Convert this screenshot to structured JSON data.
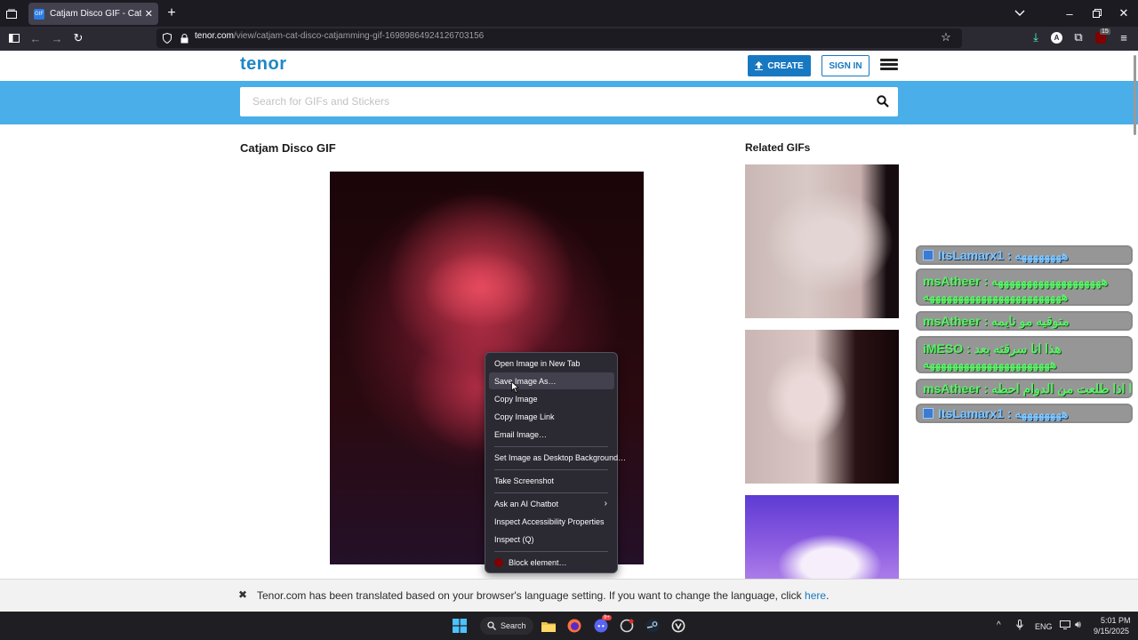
{
  "browser": {
    "tab_title": "Catjam Disco GIF - Catjam Cat Disc",
    "tab_favicon": "GIF",
    "url_host": "tenor.com",
    "url_path": "/view/catjam-cat-disco-catjamming-gif-16989864924126703156",
    "extension_badge": "15"
  },
  "site": {
    "logo": "tenor",
    "create_label": "CREATE",
    "signin_label": "SIGN IN",
    "search_placeholder": "Search for GIFs and Stickers",
    "accent": "#1778c2",
    "band_color": "#4aaee8"
  },
  "main": {
    "title": "Catjam Disco GIF",
    "related_title": "Related GIFs"
  },
  "context_menu": {
    "items": [
      "Open Image in New Tab",
      "Save Image As…",
      "Copy Image",
      "Copy Image Link",
      "Email Image…",
      "Set Image as Desktop Background…",
      "Take Screenshot",
      "Ask an AI Chatbot",
      "Inspect Accessibility Properties",
      "Inspect (Q)",
      "Block element…"
    ]
  },
  "chat": [
    {
      "user": "ItsLamarx1",
      "text": "ههههههههه"
    },
    {
      "user": "msAtheer",
      "text": "هههههههههههههههههههه",
      "text2": "ههههههههههههههههههههههههه"
    },
    {
      "user": "msAtheer",
      "text": "متوقيه مو نايمه"
    },
    {
      "user": "iMESO",
      "text": "هذا انا سرقته بعد",
      "text2": "ههههههههههههههههههههههه"
    },
    {
      "user": "msAtheer",
      "text": "هذا اذا طلعت من الدوام احطه"
    },
    {
      "user": "ItsLamarx1",
      "text": "ههههههههه"
    }
  ],
  "translation_bar": {
    "message": "Tenor.com has been translated based on your browser's language setting. If you want to change the language, click",
    "link": "here",
    "end": "."
  },
  "taskbar": {
    "search_label": "Search",
    "discord_badge": "9+",
    "lang": "ENG",
    "time": "5:01 PM",
    "date": "9/15/2025"
  }
}
